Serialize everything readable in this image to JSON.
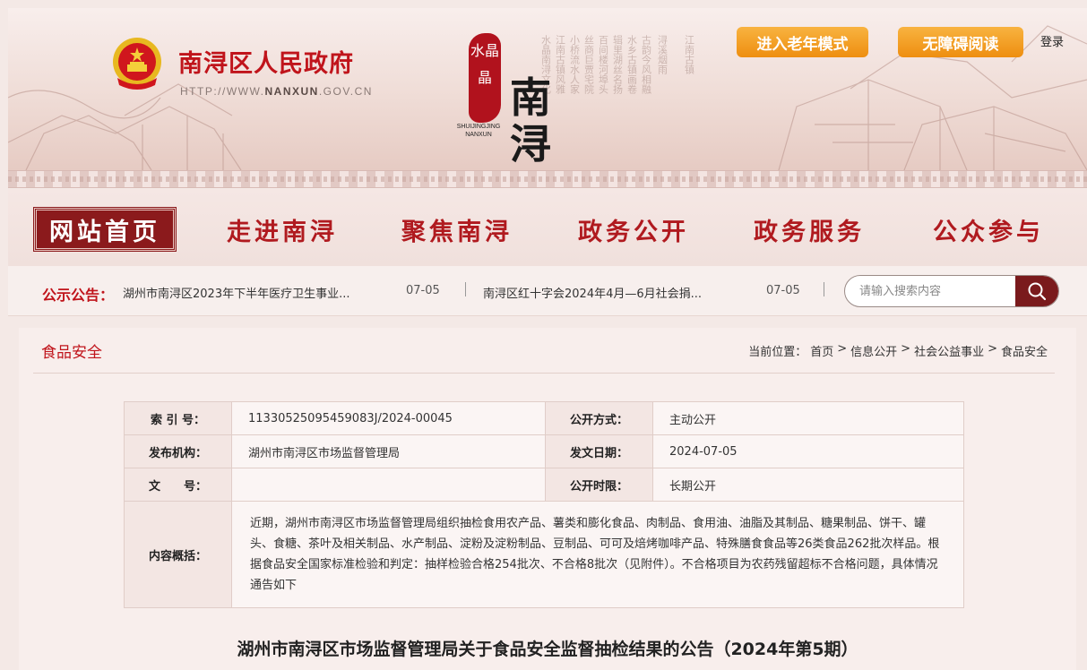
{
  "header": {
    "site_title": "南浔区人民政府",
    "site_url_prefix": "HTTP://WWW.",
    "site_url_domain": "NANXUN",
    "site_url_suffix": ".GOV.CN",
    "logo_seal": "水晶晶",
    "logo_en_1": "SHUIJINGJING",
    "logo_en_2": "NANXUN",
    "logo_big": "南浔",
    "elder_mode_label": "进入老年模式",
    "accessible_label": "无障碍阅读",
    "login_label": "登录"
  },
  "nav": {
    "items": [
      {
        "label": "网站首页",
        "active": true
      },
      {
        "label": "走进南浔",
        "active": false
      },
      {
        "label": "聚焦南浔",
        "active": false
      },
      {
        "label": "政务公开",
        "active": false
      },
      {
        "label": "政务服务",
        "active": false
      },
      {
        "label": "公众参与",
        "active": false
      }
    ]
  },
  "notice": {
    "label": "公示公告：",
    "items": [
      {
        "text": "湖州市南浔区2023年下半年医疗卫生事业...",
        "date": "07-05"
      },
      {
        "text": "南浔区红十字会2024年4月—6月社会捐...",
        "date": "07-05"
      }
    ]
  },
  "search": {
    "placeholder": "请输入搜索内容"
  },
  "content": {
    "section_title": "食品安全",
    "breadcrumb_prefix": "当前位置：",
    "breadcrumb": [
      "首页",
      "信息公开",
      "社会公益事业",
      "食品安全"
    ],
    "breadcrumb_sep": ">",
    "meta": {
      "index_key": "索 引 号：",
      "index_value": "11330525095459083J/2024-00045",
      "open_method_key": "公开方式：",
      "open_method_value": "主动公开",
      "publisher_key": "发布机构：",
      "publisher_value": "湖州市南浔区市场监督管理局",
      "date_key": "发文日期：",
      "date_value": "2024-07-05",
      "doc_no_key": "文　　号：",
      "doc_no_value": "",
      "period_key": "公开时限：",
      "period_value": "长期公开",
      "summary_key": "内容概括：",
      "summary_value": "近期，湖州市南浔区市场监督管理局组织抽检食用农产品、薯类和膨化食品、肉制品、食用油、油脂及其制品、糖果制品、饼干、罐头、食糖、茶叶及相关制品、水产制品、淀粉及淀粉制品、豆制品、可可及焙烤咖啡产品、特殊膳食食品等26类食品262批次样品。根据食品安全国家标准检验和判定：抽样检验合格254批次、不合格8批次（见附件）。不合格项目为农药残留超标不合格问题，具体情况通告如下"
    },
    "doc_title": "湖州市南浔区市场监督管理局关于食品安全监督抽检结果的公告（2024年第5期）"
  },
  "colors": {
    "brand_red": "#c0141b",
    "nav_active_bg": "#8b1a1c",
    "button_orange": "#ee8e10",
    "search_button": "#7a1a1c"
  },
  "icons": [
    "national-emblem-icon",
    "search-icon"
  ]
}
